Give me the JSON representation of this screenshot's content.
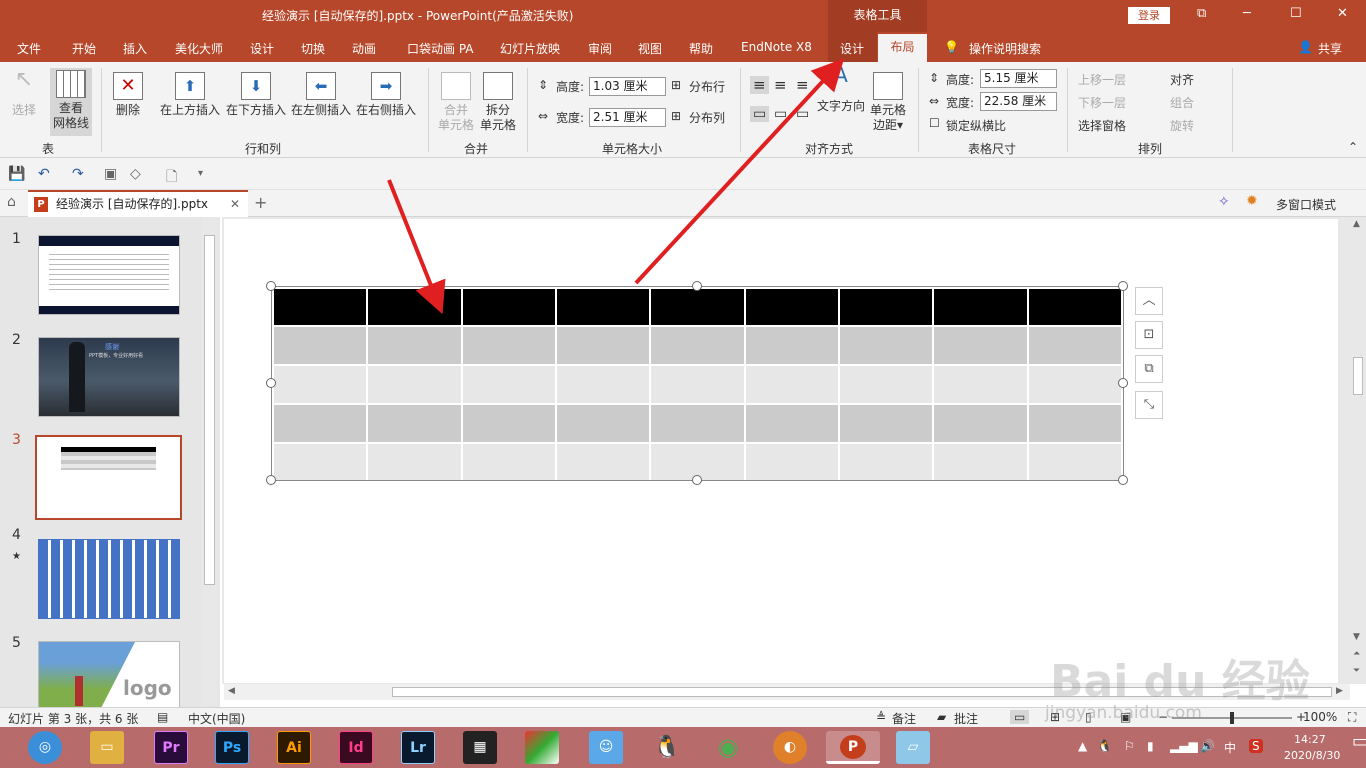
{
  "title": {
    "document": "经验演示 [自动保存的].pptx - PowerPoint(产品激活失败)",
    "context_group": "表格工具",
    "login": "登录",
    "win_buttons": [
      "⧉",
      "─",
      "☐",
      "✕"
    ]
  },
  "menu": {
    "tabs": [
      "文件",
      "开始",
      "插入",
      "美化大师",
      "设计",
      "切换",
      "动画",
      "口袋动画 PA",
      "幻灯片放映",
      "审阅",
      "视图",
      "帮助",
      "EndNote X8"
    ],
    "ctx_design": "设计",
    "ctx_layout": "布局",
    "tell_me": "操作说明搜索",
    "share": "共享"
  },
  "ribbon": {
    "table_group": {
      "select": "选择",
      "view_grid_1": "查看",
      "view_grid_2": "网格线",
      "label": "表"
    },
    "rows_cols": {
      "delete": "删除",
      "insert_above": "在上方插入",
      "insert_below": "在下方插入",
      "insert_left": "在左侧插入",
      "insert_right": "在右侧插入",
      "label": "行和列"
    },
    "merge": {
      "merge_1": "合并",
      "merge_2": "单元格",
      "split_1": "拆分",
      "split_2": "单元格",
      "label": "合并"
    },
    "cell_size": {
      "height_label": "高度:",
      "height_value": "1.03 厘米",
      "width_label": "宽度:",
      "width_value": "2.51 厘米",
      "dist_rows": "分布行",
      "dist_cols": "分布列",
      "label": "单元格大小"
    },
    "align": {
      "text_dir": "文字方向",
      "margin_1": "单元格",
      "margin_2": "边距",
      "label": "对齐方式"
    },
    "table_size": {
      "height_label": "高度:",
      "height_value": "5.15 厘米",
      "width_label": "宽度:",
      "width_value": "22.58 厘米",
      "lock": "锁定纵横比",
      "label": "表格尺寸"
    },
    "arrange": {
      "bring_forward": "上移一层",
      "send_backward": "下移一层",
      "selection_pane": "选择窗格",
      "align": "对齐",
      "group": "组合",
      "rotate": "旋转",
      "label": "排列"
    }
  },
  "doc_tab": {
    "name": "经验演示 [自动保存的].pptx",
    "multi_window": "多窗口模式"
  },
  "slides": [
    {
      "num": "1"
    },
    {
      "num": "2",
      "title": "感谢",
      "subtitle": "PPT模板，专业好用好看"
    },
    {
      "num": "3"
    },
    {
      "num": "4",
      "star": "★"
    },
    {
      "num": "5",
      "logo": "logo"
    }
  ],
  "table": {
    "columns": 9,
    "header_rows": 1,
    "body_rows": 4
  },
  "status": {
    "slide_info": "幻灯片 第 3 张，共 6 张",
    "language": "中文(中国)",
    "notes": "备注",
    "comments": "批注",
    "zoom": "100%"
  },
  "taskbar": {
    "apps": [
      "Pr",
      "Ps",
      "Ai",
      "Id",
      "Lr"
    ],
    "time": "14:27",
    "date": "2020/8/30",
    "ime": "中"
  },
  "watermark": {
    "main": "Bai du 经验",
    "url": "jingyan.baidu.com"
  },
  "colors": {
    "accent": "#b7472a",
    "arrow": "#e02020"
  }
}
